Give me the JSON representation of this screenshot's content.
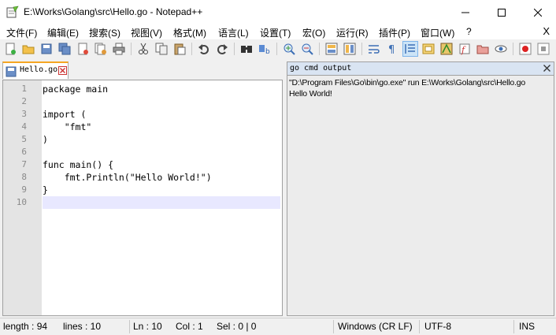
{
  "window": {
    "title": "E:\\Works\\Golang\\src\\Hello.go - Notepad++"
  },
  "menu": {
    "items": [
      "文件(F)",
      "编辑(E)",
      "搜索(S)",
      "视图(V)",
      "格式(M)",
      "语言(L)",
      "设置(T)",
      "宏(O)",
      "运行(R)",
      "插件(P)",
      "窗口(W)",
      "?"
    ],
    "close_label": "X"
  },
  "toolbar": {
    "icons": [
      "new-file-icon",
      "open-file-icon",
      "save-icon",
      "save-all-icon",
      "close-icon",
      "close-all-icon",
      "print-icon",
      "cut-icon",
      "copy-icon",
      "paste-icon",
      "undo-icon",
      "redo-icon",
      "find-icon",
      "replace-icon",
      "zoom-in-icon",
      "zoom-out-icon",
      "sync-vertical-icon",
      "sync-horizontal-icon",
      "word-wrap-icon",
      "show-all-chars-icon",
      "indent-guide-icon",
      "document-map-icon",
      "function-list-icon",
      "folder-workspace-icon",
      "monitoring-icon",
      "record-macro-icon",
      "stop-macro-icon"
    ]
  },
  "tabs": [
    {
      "label": "Hello.go"
    }
  ],
  "editor": {
    "lines": [
      {
        "num": "1",
        "text": "package main"
      },
      {
        "num": "2",
        "text": ""
      },
      {
        "num": "3",
        "text": "import ("
      },
      {
        "num": "4",
        "text": "    \"fmt\""
      },
      {
        "num": "5",
        "text": ")"
      },
      {
        "num": "6",
        "text": ""
      },
      {
        "num": "7",
        "text": "func main() {"
      },
      {
        "num": "8",
        "text": "    fmt.Println(\"Hello World!\")"
      },
      {
        "num": "9",
        "text": "}"
      },
      {
        "num": "10",
        "text": ""
      }
    ],
    "current_line": 10
  },
  "output": {
    "title": "go cmd output",
    "lines": [
      "\"D:\\Program Files\\Go\\bin\\go.exe\" run E:\\Works\\Golang\\src\\Hello.go",
      "Hello World!"
    ]
  },
  "status": {
    "length": "length : 94",
    "lines": "lines : 10",
    "ln": "Ln : 10",
    "col": "Col : 1",
    "sel": "Sel : 0 | 0",
    "eol": "Windows (CR LF)",
    "encoding": "UTF-8",
    "mode": "INS"
  },
  "colors": {
    "tab_accent": "#f5a623",
    "current_line": "#e8e8ff",
    "output_header": "#d9e4f2"
  }
}
